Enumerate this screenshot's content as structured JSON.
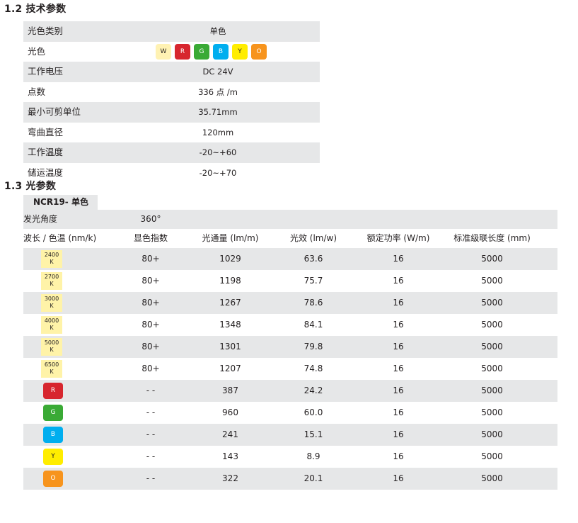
{
  "sections": {
    "tech_title": "1.2 技术参数",
    "optic_title": "1.3 光参数"
  },
  "spec": {
    "rows": [
      {
        "label": "光色类别",
        "value": "单色"
      },
      {
        "label": "光色",
        "value": ""
      },
      {
        "label": "工作电压",
        "value": "DC 24V"
      },
      {
        "label": "点数",
        "value": "336 点 /m"
      },
      {
        "label": "最小可剪单位",
        "value": "35.71mm"
      },
      {
        "label": "弯曲直径",
        "value": "120mm"
      },
      {
        "label": "工作温度",
        "value": "-20~+60"
      },
      {
        "label": "储运温度",
        "value": "-20~+70"
      }
    ],
    "chips": [
      {
        "letter": "W",
        "bg": "#fff2b3",
        "fg": "#231f20"
      },
      {
        "letter": "R",
        "bg": "#d7262e",
        "fg": "#ffffff"
      },
      {
        "letter": "G",
        "bg": "#3aaa35",
        "fg": "#ffffff"
      },
      {
        "letter": "B",
        "bg": "#00aeef",
        "fg": "#ffffff"
      },
      {
        "letter": "Y",
        "bg": "#ffed00",
        "fg": "#231f20"
      },
      {
        "letter": "O",
        "bg": "#f7941d",
        "fg": "#ffffff"
      }
    ]
  },
  "optics": {
    "tab": "NCR19- 单色",
    "angle_label": "发光角度",
    "angle_value": "360°",
    "headers": [
      "波长 / 色温 (nm/k)",
      "显色指数",
      "光通量 (lm/m)",
      "光效 (lm/w)",
      "额定功率 (W/m)",
      "标准级联长度 (mm)"
    ],
    "rows": [
      {
        "cct": "2400",
        "k": "K",
        "cri": "80+",
        "flux": "1029",
        "eff": "63.6",
        "power": "16",
        "len": "5000"
      },
      {
        "cct": "2700",
        "k": "K",
        "cri": "80+",
        "flux": "1198",
        "eff": "75.7",
        "power": "16",
        "len": "5000"
      },
      {
        "cct": "3000",
        "k": "K",
        "cri": "80+",
        "flux": "1267",
        "eff": "78.6",
        "power": "16",
        "len": "5000"
      },
      {
        "cct": "4000",
        "k": "K",
        "cri": "80+",
        "flux": "1348",
        "eff": "84.1",
        "power": "16",
        "len": "5000"
      },
      {
        "cct": "5000",
        "k": "K",
        "cri": "80+",
        "flux": "1301",
        "eff": "79.8",
        "power": "16",
        "len": "5000"
      },
      {
        "cct": "6500",
        "k": "K",
        "cri": "80+",
        "flux": "1207",
        "eff": "74.8",
        "power": "16",
        "len": "5000"
      },
      {
        "color": "R",
        "bg": "#d7262e",
        "fg": "#ffffff",
        "cri": "- -",
        "flux": "387",
        "eff": "24.2",
        "power": "16",
        "len": "5000"
      },
      {
        "color": "G",
        "bg": "#3aaa35",
        "fg": "#ffffff",
        "cri": "- -",
        "flux": "960",
        "eff": "60.0",
        "power": "16",
        "len": "5000"
      },
      {
        "color": "B",
        "bg": "#00aeef",
        "fg": "#ffffff",
        "cri": "- -",
        "flux": "241",
        "eff": "15.1",
        "power": "16",
        "len": "5000"
      },
      {
        "color": "Y",
        "bg": "#ffed00",
        "fg": "#231f20",
        "cri": "- -",
        "flux": "143",
        "eff": "8.9",
        "power": "16",
        "len": "5000"
      },
      {
        "color": "O",
        "bg": "#f7941d",
        "fg": "#ffffff",
        "cri": "- -",
        "flux": "322",
        "eff": "20.1",
        "power": "16",
        "len": "5000"
      }
    ]
  }
}
